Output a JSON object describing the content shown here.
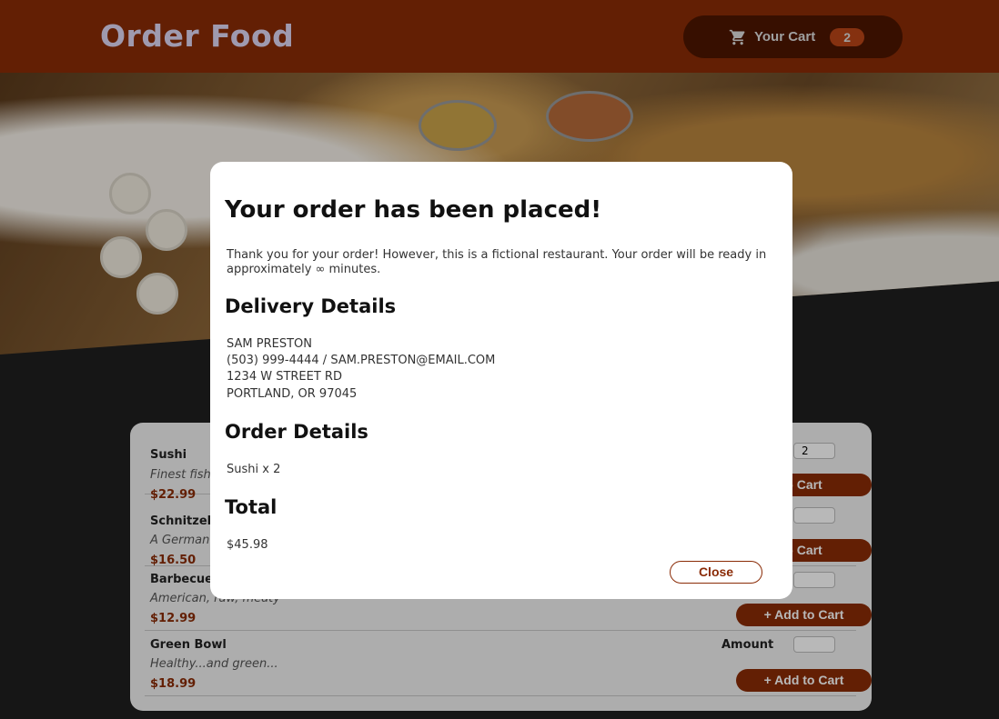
{
  "header": {
    "title": "Order Food",
    "cart_label": "Your Cart",
    "cart_count": "2"
  },
  "menu": {
    "amount_label": "Amount",
    "add_label": "+ Add to Cart",
    "meals": [
      {
        "name": "Sushi",
        "description": "Finest fish",
        "price": "$22.99",
        "amount": "2"
      },
      {
        "name": "Schnitzel",
        "description": "A German",
        "price": "$16.50",
        "amount": ""
      },
      {
        "name": "Barbecue",
        "description": "American, raw, meaty",
        "price": "$12.99",
        "amount": ""
      },
      {
        "name": "Green Bowl",
        "description": "Healthy...and green...",
        "price": "$18.99",
        "amount": ""
      }
    ],
    "partial_add_label": "o Cart"
  },
  "modal": {
    "heading": "Your order has been placed!",
    "message": "Thank you for your order! However, this is a fictional restaurant. Your order will be ready in approximately ∞ minutes.",
    "delivery_heading": "Delivery Details",
    "delivery": {
      "name": "SAM PRESTON",
      "contact": "(503) 999-4444 / SAM.PRESTON@EMAIL.COM",
      "street": "1234 W STREET RD",
      "city": "PORTLAND, OR 97045"
    },
    "order_heading": "Order Details",
    "order_items": [
      "Sushi x 2"
    ],
    "total_heading": "Total",
    "total": "$45.98",
    "close_label": "Close"
  },
  "colors": {
    "header": "#8a2b06",
    "cart_button": "#4d1601",
    "accent": "#8a2b06",
    "badge": "#b94517"
  }
}
